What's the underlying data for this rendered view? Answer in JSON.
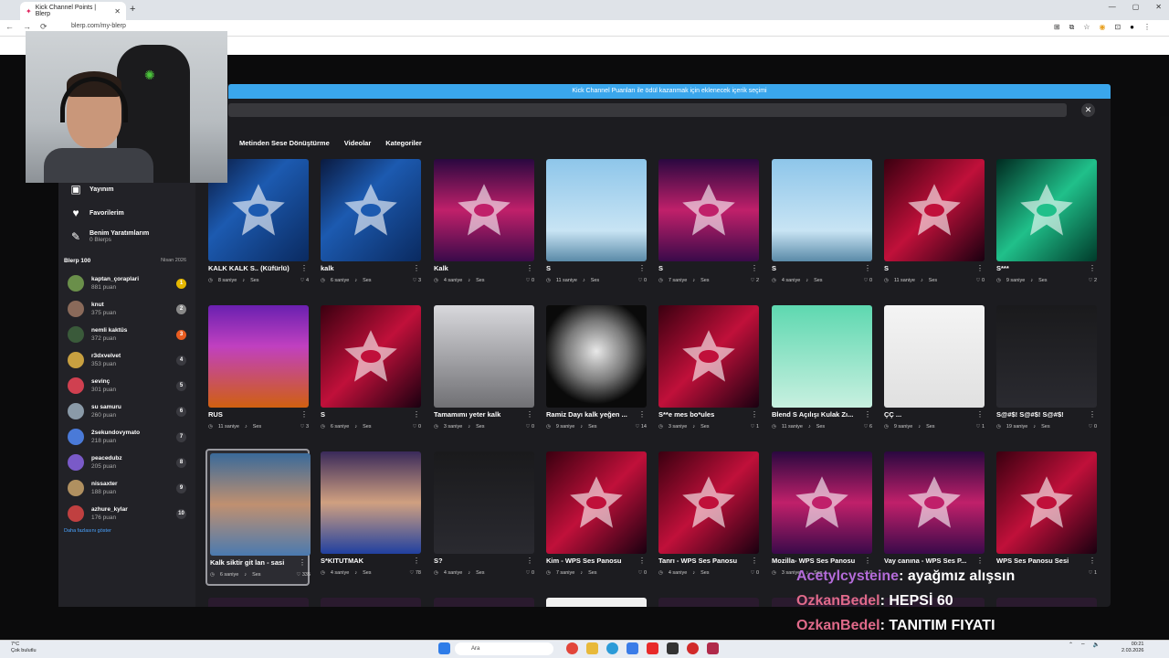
{
  "browser": {
    "tab_title": "Kick Channel Points | Blerp",
    "url": "blerp.com/my-blerp",
    "new_tab": "+",
    "window_controls": [
      "—",
      "▢",
      "✕"
    ]
  },
  "modal": {
    "banner": "Kick Channel Puanları ile ödül kazanmak için eklenecek içerik seçimi",
    "close_label": "✕",
    "tabs": [
      {
        "label": "Metinden Sese Dönüştürme"
      },
      {
        "label": "Videolar"
      },
      {
        "label": "Kategoriler"
      }
    ]
  },
  "sidebar": {
    "items": [
      {
        "label": "Yayınım",
        "sub": ""
      },
      {
        "label": "Favorilerim",
        "sub": ""
      },
      {
        "label": "Benim Yaratımlarım",
        "sub": "0 Blerps"
      }
    ],
    "leaderboard_title": "Blerp 100",
    "leaderboard_date": "Nisan 2026",
    "leaderboard": [
      {
        "name": "kaptan_çoraplari",
        "points": "881 puan",
        "rank": "1",
        "color": "#e6b800"
      },
      {
        "name": "knut",
        "points": "375 puan",
        "rank": "2",
        "color": "#888888"
      },
      {
        "name": "nemli kaktüs",
        "points": "372 puan",
        "rank": "3",
        "color": "#e85c20"
      },
      {
        "name": "r3dxvelvet",
        "points": "353 puan",
        "rank": "4",
        "color": "#3a3a40"
      },
      {
        "name": "sevinç",
        "points": "301 puan",
        "rank": "5",
        "color": "#3a3a40"
      },
      {
        "name": "su samuru",
        "points": "260 puan",
        "rank": "6",
        "color": "#3a3a40"
      },
      {
        "name": "2sekundovymato",
        "points": "218 puan",
        "rank": "7",
        "color": "#3a3a40"
      },
      {
        "name": "peacedubz",
        "points": "205 puan",
        "rank": "8",
        "color": "#3a3a40"
      },
      {
        "name": "nissaxter",
        "points": "188 puan",
        "rank": "9",
        "color": "#3a3a40"
      },
      {
        "name": "azhure_kylar",
        "points": "176 puan",
        "rank": "10",
        "color": "#3a3a40"
      }
    ],
    "show_more": "Daha fazlasını göster"
  },
  "grid": {
    "type_label": "Ses",
    "rows": [
      [
        {
          "title": "KALK KALK S.. (Küfürlü)",
          "duration": "8 saniye",
          "likes": "4",
          "thumb": "wave"
        },
        {
          "title": "kalk",
          "duration": "6 saniye",
          "likes": "3",
          "thumb": "wave"
        },
        {
          "title": "Kalk",
          "duration": "4 saniye",
          "likes": "0",
          "thumb": "pink"
        },
        {
          "title": "S",
          "duration": "11 saniye",
          "likes": "0",
          "thumb": "flag"
        },
        {
          "title": "S",
          "duration": "7 saniye",
          "likes": "2",
          "thumb": "pink"
        },
        {
          "title": "S",
          "duration": "4 saniye",
          "likes": "0",
          "thumb": "flag"
        },
        {
          "title": "S",
          "duration": "11 saniye",
          "likes": "0",
          "thumb": "red"
        },
        {
          "title": "S***",
          "duration": "9 saniye",
          "likes": "2",
          "thumb": "green"
        }
      ],
      [
        {
          "title": "RUS",
          "duration": "11 saniye",
          "likes": "3",
          "thumb": "stage"
        },
        {
          "title": "S",
          "duration": "6 saniye",
          "likes": "0",
          "thumb": "red"
        },
        {
          "title": "Tamamımı yeter kalk",
          "duration": "3 saniye",
          "likes": "0",
          "thumb": "photo"
        },
        {
          "title": "Ramiz Dayı kalk yeğen ...",
          "duration": "9 saniye",
          "likes": "14",
          "thumb": "bw"
        },
        {
          "title": "S**e mes bo*ules",
          "duration": "3 saniye",
          "likes": "1",
          "thumb": "red"
        },
        {
          "title": "Blend S Açılışı Kulak Zı...",
          "duration": "11 saniye",
          "likes": "6",
          "thumb": "anime"
        },
        {
          "title": "ÇÇ ...",
          "duration": "9 saniye",
          "likes": "1",
          "thumb": "white"
        },
        {
          "title": "S@#$! S@#$! S@#$!",
          "duration": "19 saniye",
          "likes": "0",
          "thumb": "dark"
        }
      ],
      [
        {
          "title": "Kalk siktir git lan - sasi",
          "duration": "6 saniye",
          "likes": "335",
          "thumb": "face"
        },
        {
          "title": "S*KITUTMAK",
          "duration": "4 saniye",
          "likes": "78",
          "thumb": "tv"
        },
        {
          "title": "S?",
          "duration": "4 saniye",
          "likes": "0",
          "thumb": "dark"
        },
        {
          "title": "Kim - WPS Ses Panosu",
          "duration": "7 saniye",
          "likes": "0",
          "thumb": "red"
        },
        {
          "title": "Tanrı - WPS Ses Panosu",
          "duration": "4 saniye",
          "likes": "0",
          "thumb": "red"
        },
        {
          "title": "Mozilla- WPS Ses Panosu",
          "duration": "3 saniye",
          "likes": "0",
          "thumb": "pink"
        },
        {
          "title": "Vay canına - WPS Ses P...",
          "duration": "",
          "likes": "",
          "thumb": "pink"
        },
        {
          "title": "WPS Ses Panosu Sesi",
          "duration": "",
          "likes": "1",
          "thumb": "red"
        }
      ]
    ]
  },
  "chat": [
    {
      "user": "Acetylcysteine",
      "message": ": ayağmız alışsın",
      "color": "#b36bd8"
    },
    {
      "user": "OzkanBedel",
      "message": ": HEPSİ 60",
      "color": "#e06a8a"
    },
    {
      "user": "OzkanBedel",
      "message": ": TANITIM FIYATI",
      "color": "#e06a8a"
    }
  ],
  "taskbar": {
    "weather_temp": "7°C",
    "weather_desc": "Çok bulutlu",
    "search_placeholder": "Ara",
    "time": "00:21",
    "date": "2.03.2026"
  },
  "colors": {
    "banner": "#3aa6ec",
    "selected_tab": "#2a2a2f",
    "link": "#4aa3ff"
  }
}
